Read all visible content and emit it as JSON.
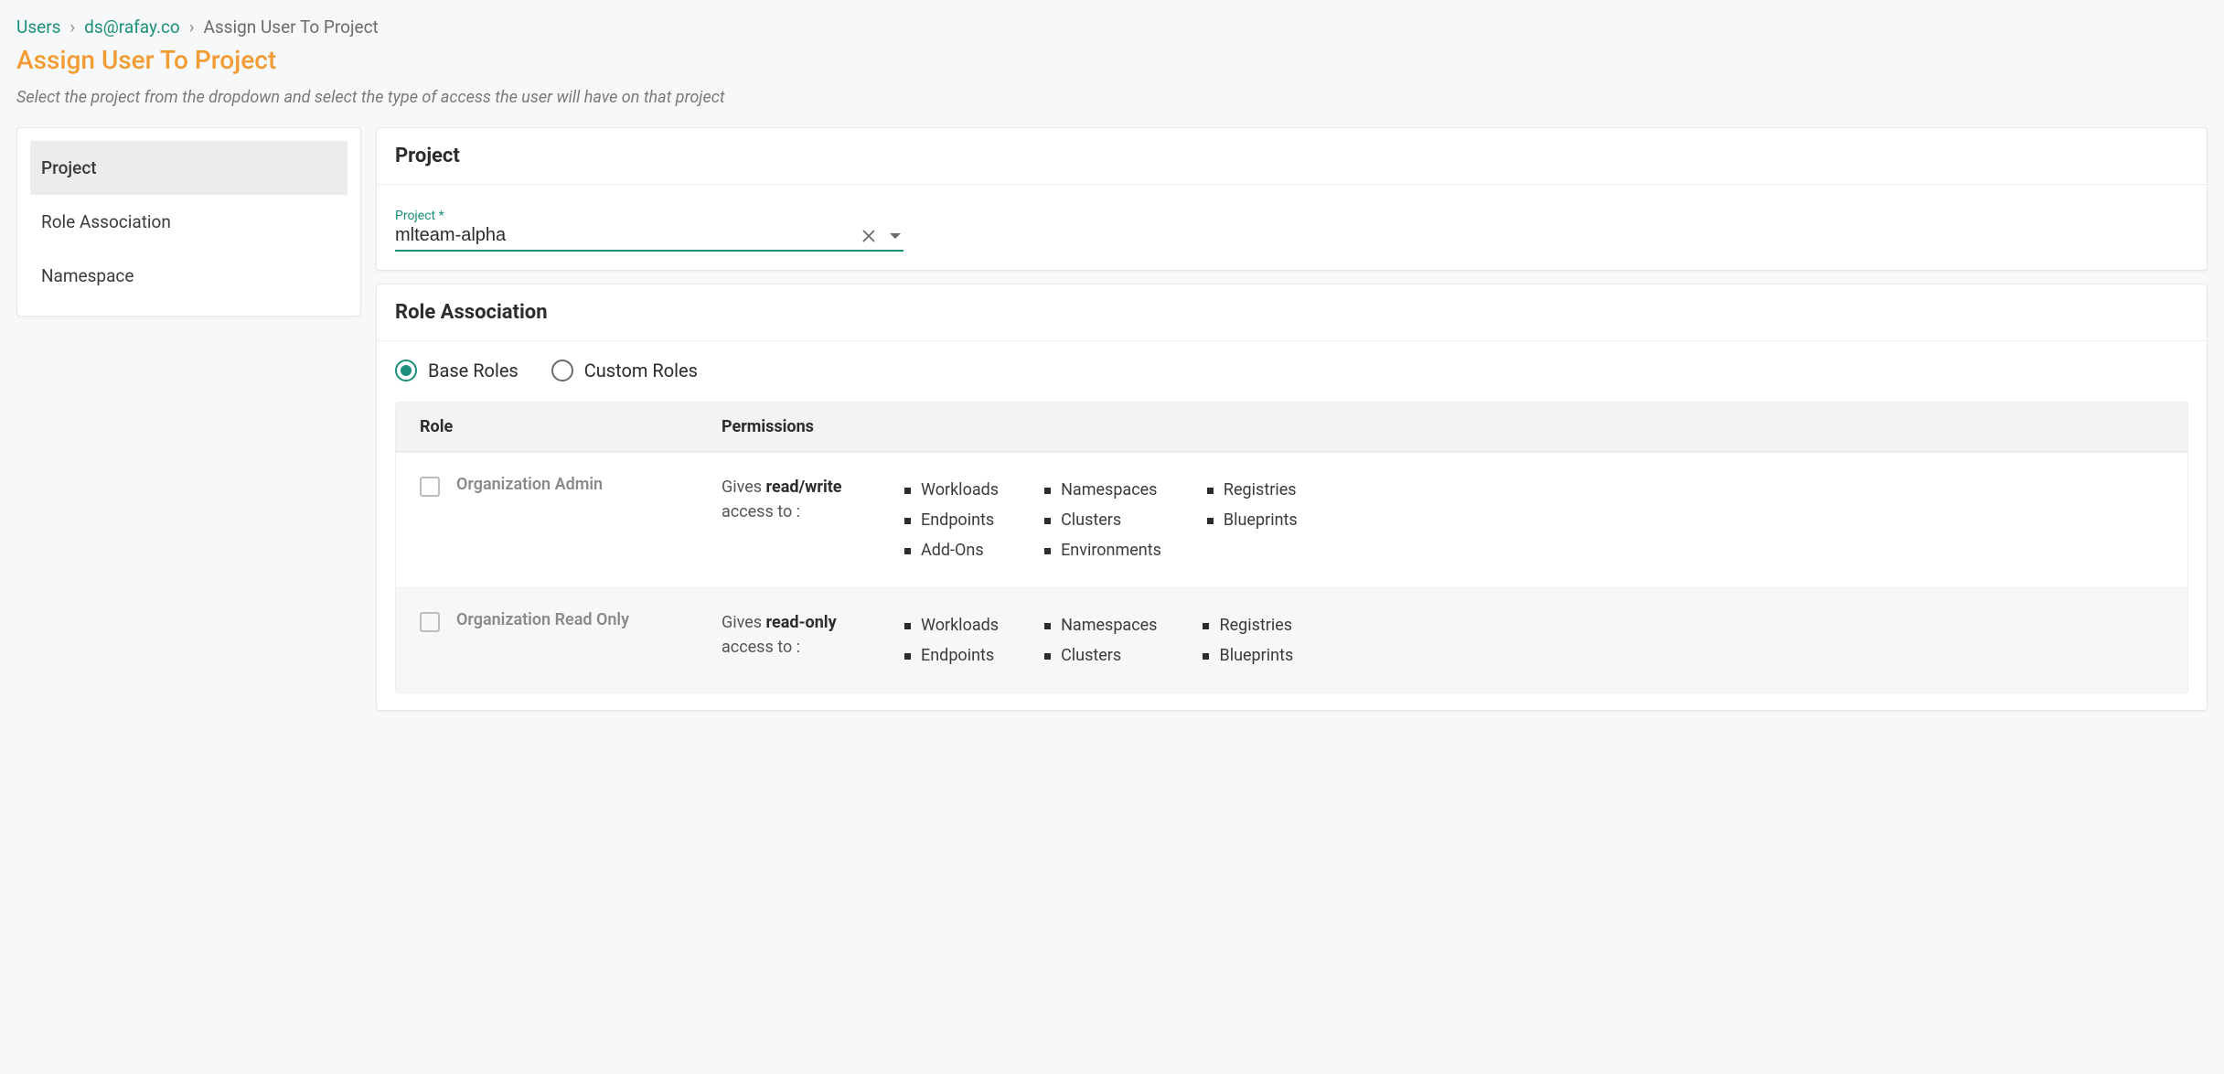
{
  "breadcrumb": {
    "users": "Users",
    "email": "ds@rafay.co",
    "current": "Assign User To Project"
  },
  "page": {
    "title": "Assign User To Project",
    "subtitle": "Select the project from the dropdown and select the type of access the user will have on that project"
  },
  "sidebar": {
    "items": [
      {
        "label": "Project",
        "active": true
      },
      {
        "label": "Role Association",
        "active": false
      },
      {
        "label": "Namespace",
        "active": false
      }
    ]
  },
  "projectCard": {
    "header": "Project",
    "fieldLabel": "Project *",
    "value": "mlteam-alpha"
  },
  "roleCard": {
    "header": "Role Association",
    "radios": {
      "base": "Base Roles",
      "custom": "Custom Roles",
      "selected": "base"
    },
    "tableHead": {
      "role": "Role",
      "perm": "Permissions"
    },
    "rows": [
      {
        "name": "Organization Admin",
        "permPrefix": "Gives ",
        "permBold": "read/write",
        "permSuffix": " access to :",
        "cols": [
          [
            "Workloads",
            "Endpoints",
            "Add-Ons"
          ],
          [
            "Namespaces",
            "Clusters",
            "Environments"
          ],
          [
            "Registries",
            "Blueprints"
          ]
        ]
      },
      {
        "name": "Organization Read Only",
        "permPrefix": "Gives ",
        "permBold": "read-only",
        "permSuffix": " access to :",
        "cols": [
          [
            "Workloads",
            "Endpoints"
          ],
          [
            "Namespaces",
            "Clusters"
          ],
          [
            "Registries",
            "Blueprints"
          ]
        ]
      }
    ]
  }
}
